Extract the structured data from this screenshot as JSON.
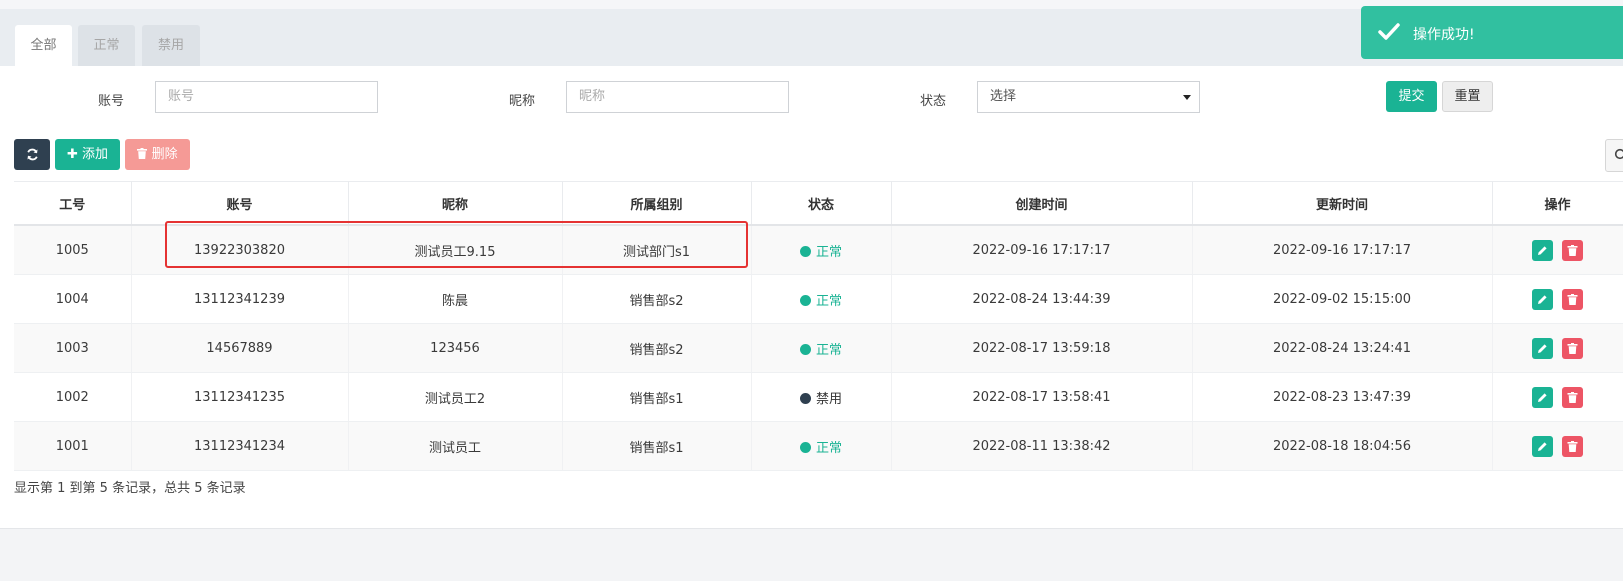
{
  "tabs": [
    "全部",
    "正常",
    "禁用"
  ],
  "filters": {
    "account_label": "账号",
    "account_placeholder": "账号",
    "nickname_label": "昵称",
    "nickname_placeholder": "昵称",
    "status_label": "状态",
    "status_value": "选择",
    "submit": "提交",
    "reset": "重置"
  },
  "toolbar": {
    "add": "添加",
    "delete": "删除"
  },
  "table": {
    "headers": [
      "工号",
      "账号",
      "昵称",
      "所属组别",
      "状态",
      "创建时间",
      "更新时间",
      "操作"
    ],
    "rows": [
      {
        "id": "1005",
        "account": "13922303820",
        "nickname": "测试员工9.15",
        "group": "测试部门s1",
        "status": "正常",
        "created": "2022-09-16 17:17:17",
        "updated": "2022-09-16 17:17:17"
      },
      {
        "id": "1004",
        "account": "13112341239",
        "nickname": "陈晨",
        "group": "销售部s2",
        "status": "正常",
        "created": "2022-08-24 13:44:39",
        "updated": "2022-09-02 15:15:00"
      },
      {
        "id": "1003",
        "account": "14567889",
        "nickname": "123456",
        "group": "销售部s2",
        "status": "正常",
        "created": "2022-08-17 13:59:18",
        "updated": "2022-08-24 13:24:41"
      },
      {
        "id": "1002",
        "account": "13112341235",
        "nickname": "测试员工2",
        "group": "销售部s1",
        "status": "禁用",
        "created": "2022-08-17 13:58:41",
        "updated": "2022-08-23 13:47:39"
      },
      {
        "id": "1001",
        "account": "13112341234",
        "nickname": "测试员工",
        "group": "销售部s1",
        "status": "正常",
        "created": "2022-08-11 13:38:42",
        "updated": "2022-08-18 18:04:56"
      }
    ]
  },
  "pagination_text": "显示第 1 到第 5 条记录，总共 5 条记录",
  "toast": "操作成功!",
  "colors": {
    "accent": "#1ab394",
    "danger": "#ed5565",
    "dark": "#2f4050",
    "highlight": "#e53333"
  }
}
